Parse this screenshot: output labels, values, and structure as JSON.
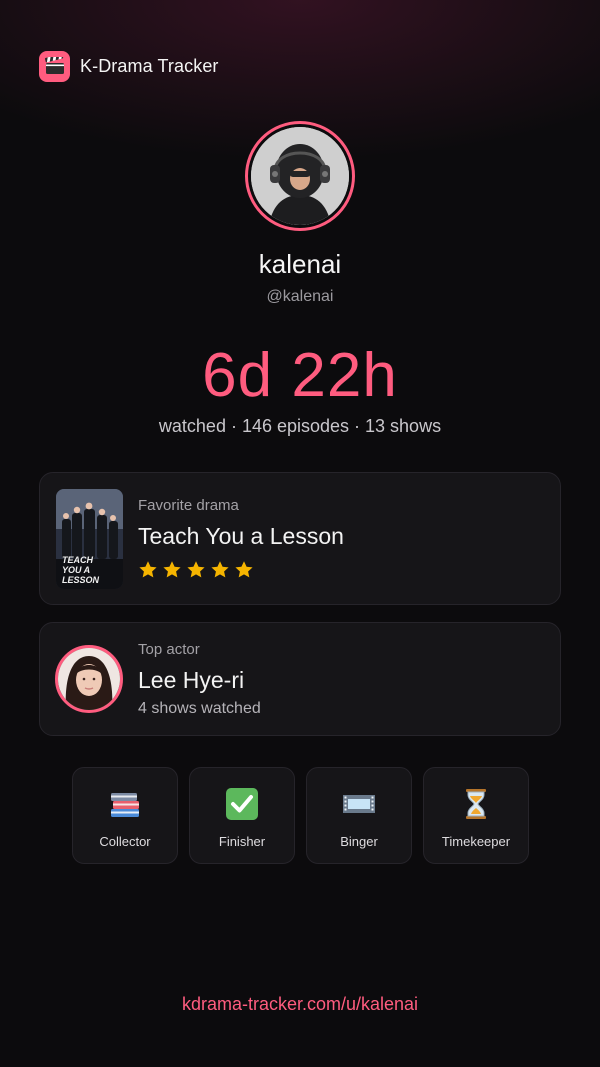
{
  "app": {
    "title": "K-Drama Tracker",
    "brand_icon": "clapperboard-icon",
    "accent": "#ff5c7f"
  },
  "profile": {
    "display_name": "kalenai",
    "handle": "@kalenai",
    "avatar": "avatar-hooded-figure-headphones"
  },
  "summary": {
    "watch_time": "6d 22h",
    "stats": "watched · 146 episodes · 13 shows"
  },
  "favorite": {
    "label": "Favorite drama",
    "title": "Teach You a Lesson",
    "poster_text": "TEACH YOU A LESSON",
    "rating": 5,
    "rating_max": 5,
    "star_color": "#f5b400"
  },
  "top_actor": {
    "label": "Top actor",
    "name": "Lee Hye-ri",
    "detail": "4 shows watched"
  },
  "badges": [
    {
      "label": "Collector",
      "icon": "books-icon"
    },
    {
      "label": "Finisher",
      "icon": "check-mark-icon"
    },
    {
      "label": "Binger",
      "icon": "film-strip-icon"
    },
    {
      "label": "Timekeeper",
      "icon": "hourglass-icon"
    }
  ],
  "footer": {
    "url": "kdrama-tracker.com/u/kalenai"
  }
}
